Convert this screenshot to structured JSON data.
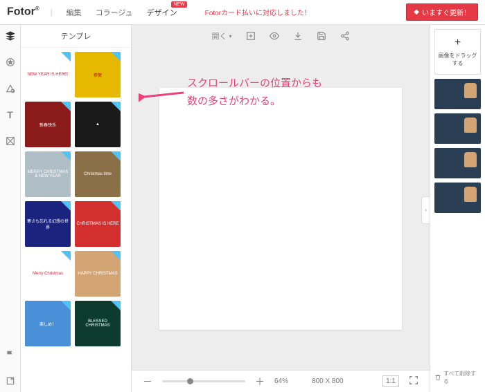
{
  "header": {
    "logo": "Fotor",
    "nav": {
      "edit": "編集",
      "collage": "コラージュ",
      "design": "デザイン",
      "new_badge": "NEW"
    },
    "promo": "Fotorカード払いに対応しました！",
    "update_btn": "いますぐ更新！"
  },
  "panel": {
    "title": "テンプレ"
  },
  "templates": [
    {
      "bg": "#fff",
      "text": "NEW YEAR IS HERE!",
      "color": "#c92a3a"
    },
    {
      "bg": "#e6b800",
      "text": "恭贺",
      "color": "#b30000"
    },
    {
      "bg": "#8b1a1a",
      "text": "新春快乐"
    },
    {
      "bg": "#1a1a1a",
      "text": "▲"
    },
    {
      "bg": "#b0bec5",
      "text": "MERRY CHRISTMAS & NEW YEAR"
    },
    {
      "bg": "#8b6f47",
      "text": "Christmas time"
    },
    {
      "bg": "#1a237e",
      "text": "寒さも忘れる幻想の世界"
    },
    {
      "bg": "#d32f2f",
      "text": "CHRISTMAS IS HERE"
    },
    {
      "bg": "#fff",
      "text": "Merry Christmas",
      "color": "#c92a3a"
    },
    {
      "bg": "#d4a574",
      "text": "HAPPY CHRISTMAS"
    },
    {
      "bg": "#4a90d9",
      "text": "楽しめ！"
    },
    {
      "bg": "#0d3b2e",
      "text": "BLESSED CHRISTMAS"
    }
  ],
  "toolbar": {
    "open": "開く"
  },
  "bottom": {
    "zoom": "64%",
    "dims": "800 X 800",
    "ratio": "1:1"
  },
  "right": {
    "drop": "画像をドラッグする",
    "delete": "すべて削除する"
  },
  "annotation": {
    "line1": "スクロールバーの位置からも",
    "line2": "数の多さがわかる。"
  }
}
